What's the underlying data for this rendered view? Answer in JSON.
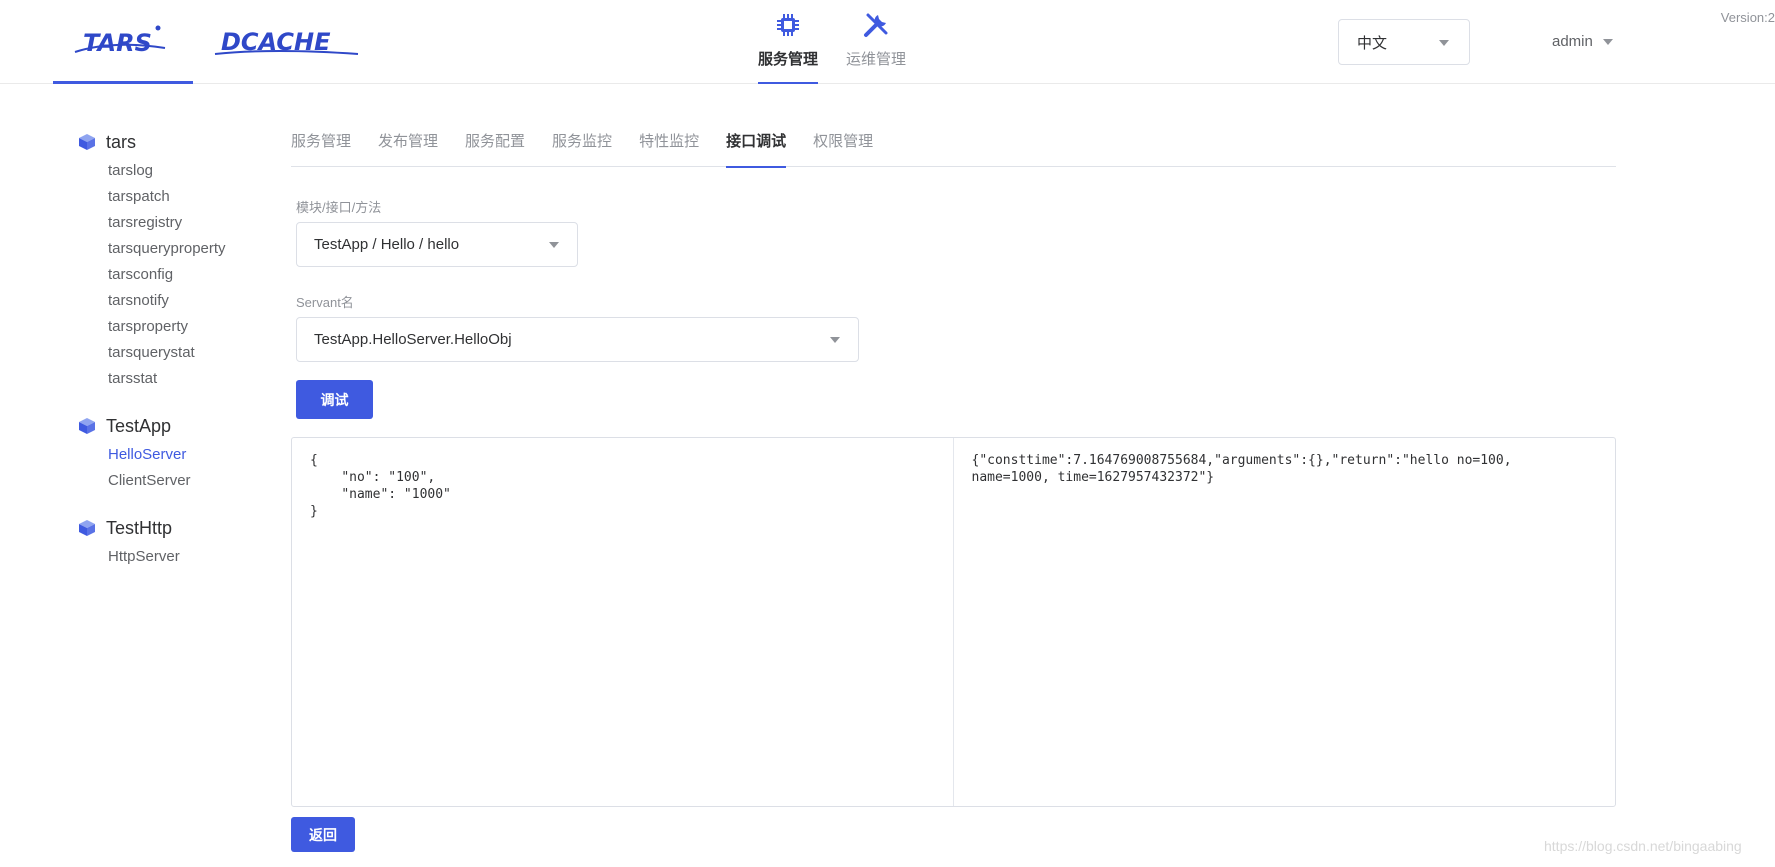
{
  "header": {
    "logo_tars": "TARS",
    "logo_dcache": "DCACHE",
    "nav": [
      {
        "label": "服务管理",
        "icon": "chip-icon",
        "active": true
      },
      {
        "label": "运维管理",
        "icon": "wrench-icon",
        "active": false
      }
    ],
    "language": "中文",
    "user": "admin",
    "version": "Version:2"
  },
  "sidebar": {
    "groups": [
      {
        "name": "tars",
        "servers": [
          "tarslog",
          "tarspatch",
          "tarsregistry",
          "tarsqueryproperty",
          "tarsconfig",
          "tarsnotify",
          "tarsproperty",
          "tarsquerystat",
          "tarsstat"
        ]
      },
      {
        "name": "TestApp",
        "servers": [
          "HelloServer",
          "ClientServer"
        ],
        "active_server": "HelloServer"
      },
      {
        "name": "TestHttp",
        "servers": [
          "HttpServer"
        ]
      }
    ]
  },
  "main": {
    "tabs": [
      "服务管理",
      "发布管理",
      "服务配置",
      "服务监控",
      "特性监控",
      "接口调试",
      "权限管理"
    ],
    "active_tab": "接口调试",
    "method_label": "模块/接口/方法",
    "method_value": "TestApp / Hello / hello",
    "servant_label": "Servant名",
    "servant_value": "TestApp.HelloServer.HelloObj",
    "debug_button": "调试",
    "request_body": "{\n    \"no\": \"100\",\n    \"name\": \"1000\"\n}",
    "response_body": "{\"consttime\":7.164769008755684,\"arguments\":{},\"return\":\"hello no=100, name=1000, time=1627957432372\"}",
    "back_button": "返回"
  },
  "watermark": "https://blog.csdn.net/bingaabing",
  "colors": {
    "accent": "#3f5ae0",
    "logo": "#2f48c8"
  }
}
